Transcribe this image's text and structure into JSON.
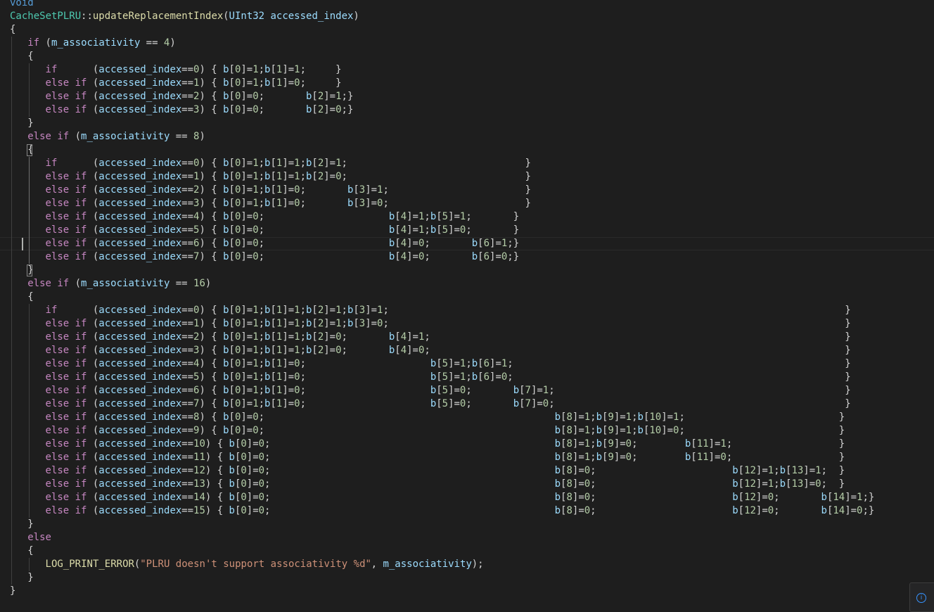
{
  "editor": {
    "language": "cpp",
    "current_line_index": 18,
    "lines": [
      "void",
      "CacheSetPLRU::updateReplacementIndex(UInt32 accessed_index)",
      "{",
      "   if (m_associativity == 4)",
      "   {",
      "      if      (accessed_index==0) { b[0]=1;b[1]=1;     }",
      "      else if (accessed_index==1) { b[0]=1;b[1]=0;     }",
      "      else if (accessed_index==2) { b[0]=0;       b[2]=1;}",
      "      else if (accessed_index==3) { b[0]=0;       b[2]=0;}",
      "   }",
      "   else if (m_associativity == 8)",
      "   {",
      "      if      (accessed_index==0) { b[0]=1;b[1]=1;b[2]=1;                              }",
      "      else if (accessed_index==1) { b[0]=1;b[1]=1;b[2]=0;                              }",
      "      else if (accessed_index==2) { b[0]=1;b[1]=0;       b[3]=1;                       }",
      "      else if (accessed_index==3) { b[0]=1;b[1]=0;       b[3]=0;                       }",
      "      else if (accessed_index==4) { b[0]=0;                     b[4]=1;b[5]=1;       }",
      "      else if (accessed_index==5) { b[0]=0;                     b[4]=1;b[5]=0;       }",
      "      else if (accessed_index==6) { b[0]=0;                     b[4]=0;       b[6]=1;}",
      "      else if (accessed_index==7) { b[0]=0;                     b[4]=0;       b[6]=0;}",
      "   }",
      "   else if (m_associativity == 16)",
      "   {",
      "      if      (accessed_index==0) { b[0]=1;b[1]=1;b[2]=1;b[3]=1;                                                                             }",
      "      else if (accessed_index==1) { b[0]=1;b[1]=1;b[2]=1;b[3]=0;                                                                             }",
      "      else if (accessed_index==2) { b[0]=1;b[1]=1;b[2]=0;       b[4]=1;                                                                      }",
      "      else if (accessed_index==3) { b[0]=1;b[1]=1;b[2]=0;       b[4]=0;                                                                      }",
      "      else if (accessed_index==4) { b[0]=1;b[1]=0;                     b[5]=1;b[6]=1;                                                        }",
      "      else if (accessed_index==5) { b[0]=1;b[1]=0;                     b[5]=1;b[6]=0;                                                        }",
      "      else if (accessed_index==6) { b[0]=1;b[1]=0;                     b[5]=0;       b[7]=1;                                                 }",
      "      else if (accessed_index==7) { b[0]=1;b[1]=0;                     b[5]=0;       b[7]=0;                                                 }",
      "      else if (accessed_index==8) { b[0]=0;                                                 b[8]=1;b[9]=1;b[10]=1;                          }",
      "      else if (accessed_index==9) { b[0]=0;                                                 b[8]=1;b[9]=1;b[10]=0;                          }",
      "      else if (accessed_index==10) { b[0]=0;                                                b[8]=1;b[9]=0;        b[11]=1;                  }",
      "      else if (accessed_index==11) { b[0]=0;                                                b[8]=1;b[9]=0;        b[11]=0;                  }",
      "      else if (accessed_index==12) { b[0]=0;                                                b[8]=0;                       b[12]=1;b[13]=1;  }",
      "      else if (accessed_index==13) { b[0]=0;                                                b[8]=0;                       b[12]=1;b[13]=0;  }",
      "      else if (accessed_index==14) { b[0]=0;                                                b[8]=0;                       b[12]=0;       b[14]=1;}",
      "      else if (accessed_index==15) { b[0]=0;                                                b[8]=0;                       b[12]=0;       b[14]=0;}",
      "   }",
      "   else",
      "   {",
      "      LOG_PRINT_ERROR(\"PLRU doesn't support associativity %d\", m_associativity);",
      "   }",
      "}"
    ]
  },
  "notification": {
    "icon": "info-icon",
    "glyph": "i"
  }
}
